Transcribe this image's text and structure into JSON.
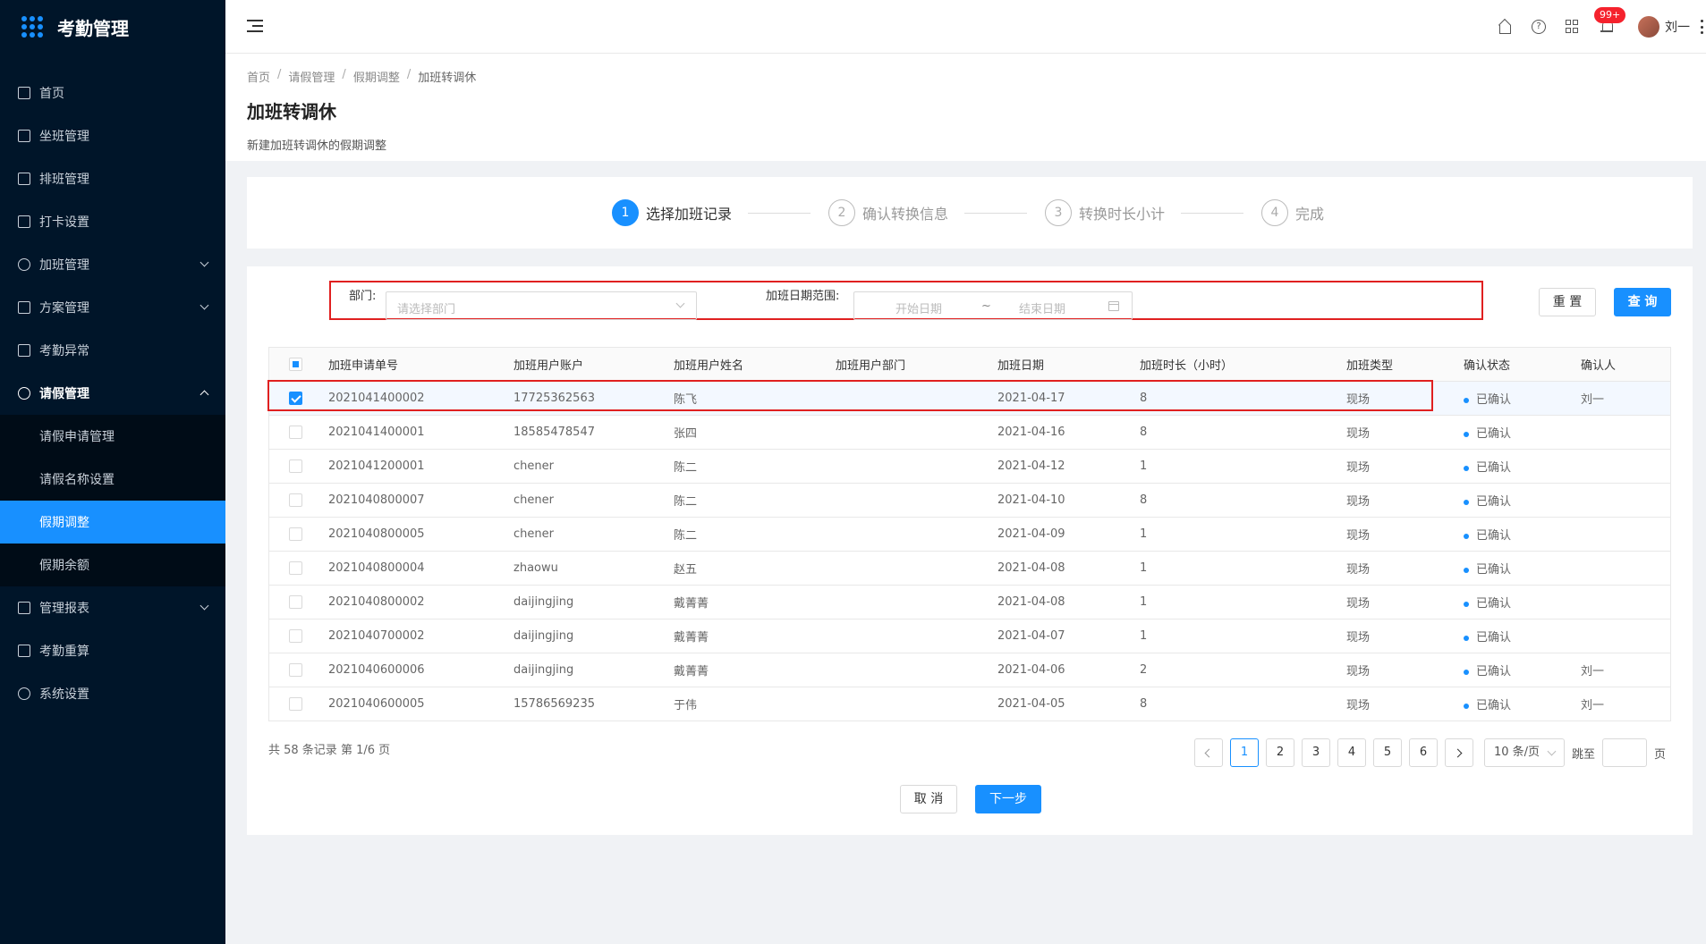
{
  "app": {
    "title": "考勤管理"
  },
  "sidebar": {
    "items": [
      {
        "label": "首页"
      },
      {
        "label": "坐班管理"
      },
      {
        "label": "排班管理"
      },
      {
        "label": "打卡设置"
      },
      {
        "label": "加班管理"
      },
      {
        "label": "方案管理"
      },
      {
        "label": "考勤异常"
      },
      {
        "label": "请假管理"
      },
      {
        "label": "管理报表"
      },
      {
        "label": "考勤重算"
      },
      {
        "label": "系统设置"
      }
    ],
    "submenu": [
      {
        "label": "请假申请管理"
      },
      {
        "label": "请假名称设置"
      },
      {
        "label": "假期调整"
      },
      {
        "label": "假期余额"
      }
    ]
  },
  "header": {
    "badge": "99+",
    "user_name": "刘一"
  },
  "breadcrumb": [
    "首页",
    "请假管理",
    "假期调整",
    "加班转调休"
  ],
  "page": {
    "title": "加班转调休",
    "description": "新建加班转调休的假期调整"
  },
  "steps": [
    {
      "num": "1",
      "label": "选择加班记录"
    },
    {
      "num": "2",
      "label": "确认转换信息"
    },
    {
      "num": "3",
      "label": "转换时长小计"
    },
    {
      "num": "4",
      "label": "完成"
    }
  ],
  "filter": {
    "dept_label": "部门:",
    "dept_placeholder": "请选择部门",
    "date_label": "加班日期范围:",
    "start_placeholder": "开始日期",
    "tilde": "~",
    "end_placeholder": "结束日期",
    "reset_label": "重 置",
    "query_label": "查 询"
  },
  "table": {
    "columns": [
      "加班申请单号",
      "加班用户账户",
      "加班用户姓名",
      "加班用户部门",
      "加班日期",
      "加班时长（小时）",
      "加班类型",
      "确认状态",
      "确认人"
    ],
    "rows": [
      [
        "2021041400002",
        "17725362563",
        "陈飞",
        "",
        "2021-04-17",
        "8",
        "现场",
        "已确认",
        "刘一"
      ],
      [
        "2021041400001",
        "18585478547",
        "张四",
        "",
        "2021-04-16",
        "8",
        "现场",
        "已确认",
        ""
      ],
      [
        "2021041200001",
        "chener",
        "陈二",
        "",
        "2021-04-12",
        "1",
        "现场",
        "已确认",
        ""
      ],
      [
        "2021040800007",
        "chener",
        "陈二",
        "",
        "2021-04-10",
        "8",
        "现场",
        "已确认",
        ""
      ],
      [
        "2021040800005",
        "chener",
        "陈二",
        "",
        "2021-04-09",
        "1",
        "现场",
        "已确认",
        ""
      ],
      [
        "2021040800004",
        "zhaowu",
        "赵五",
        "",
        "2021-04-08",
        "1",
        "现场",
        "已确认",
        ""
      ],
      [
        "2021040800002",
        "daijingjing",
        "戴菁菁",
        "",
        "2021-04-08",
        "1",
        "现场",
        "已确认",
        ""
      ],
      [
        "2021040700002",
        "daijingjing",
        "戴菁菁",
        "",
        "2021-04-07",
        "1",
        "现场",
        "已确认",
        ""
      ],
      [
        "2021040600006",
        "daijingjing",
        "戴菁菁",
        "",
        "2021-04-06",
        "2",
        "现场",
        "已确认",
        "刘一"
      ],
      [
        "2021040600005",
        "15786569235",
        "于伟",
        "",
        "2021-04-05",
        "8",
        "现场",
        "已确认",
        "刘一"
      ]
    ]
  },
  "pagination": {
    "total_text": "共 58 条记录 第 1/6 页",
    "pages": [
      "1",
      "2",
      "3",
      "4",
      "5",
      "6"
    ],
    "page_size": "10 条/页",
    "jump_label": "跳至",
    "page_unit": "页"
  },
  "actions": {
    "cancel_label": "取 消",
    "next_label": "下一步"
  },
  "colors": {
    "primary": "#1890ff",
    "sidebar_bg": "#001529",
    "highlight": "#e02020"
  }
}
